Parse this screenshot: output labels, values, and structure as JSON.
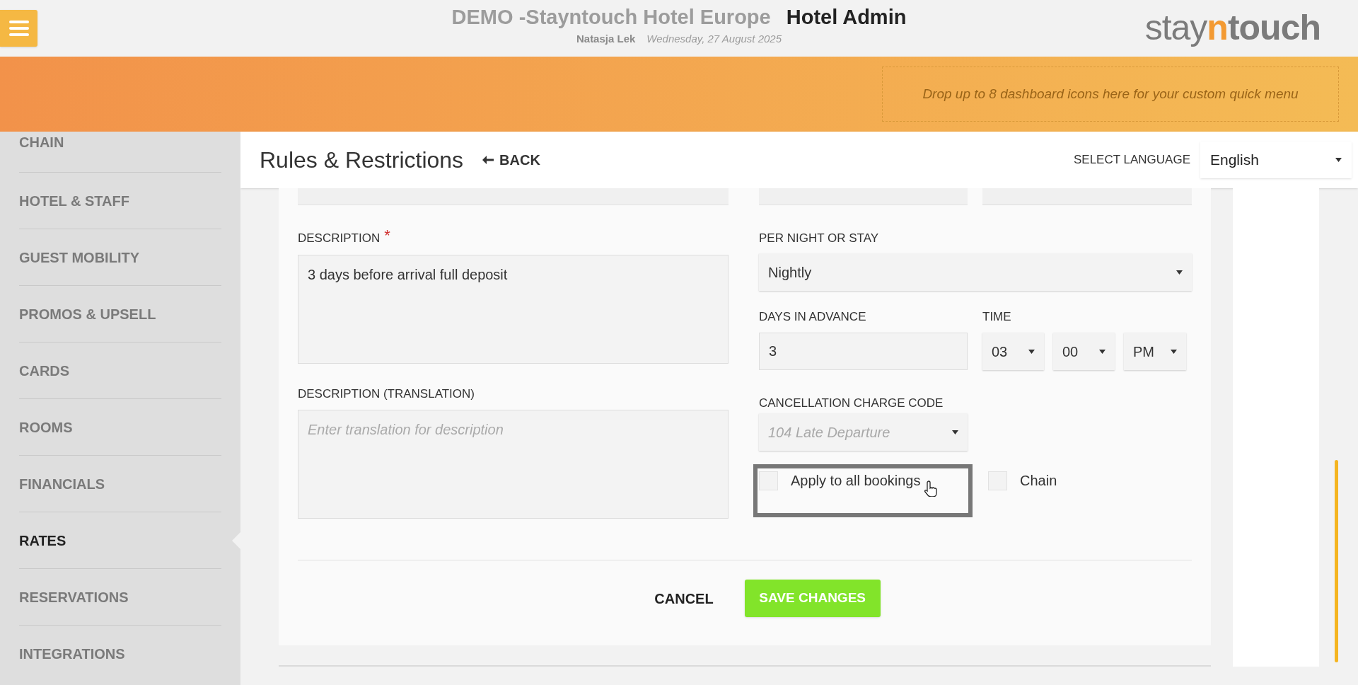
{
  "header": {
    "title": "DEMO -Stayntouch Hotel Europe",
    "app_name": "Hotel Admin",
    "user": "Natasja Lek",
    "date": "Wednesday, 27 August 2025",
    "logo": [
      {
        "text": "stay",
        "color": "#7b7b7b"
      },
      {
        "text": "n",
        "color": "#f39a32"
      },
      {
        "text": "touch",
        "color": "#7b7b7b"
      }
    ]
  },
  "quick_menu": {
    "hint": "Drop up to 8 dashboard icons here for your custom quick menu"
  },
  "sidebar": {
    "items": [
      {
        "label": "CHAIN",
        "selected": false
      },
      {
        "label": "HOTEL & STAFF",
        "selected": false
      },
      {
        "label": "GUEST MOBILITY",
        "selected": false
      },
      {
        "label": "PROMOS & UPSELL",
        "selected": false
      },
      {
        "label": "CARDS",
        "selected": false
      },
      {
        "label": "ROOMS",
        "selected": false
      },
      {
        "label": "FINANCIALS",
        "selected": false
      },
      {
        "label": "RATES",
        "selected": true
      },
      {
        "label": "RESERVATIONS",
        "selected": false
      },
      {
        "label": "INTEGRATIONS",
        "selected": false
      }
    ]
  },
  "page": {
    "title": "Rules & Restrictions",
    "back": "BACK",
    "language_label": "SELECT LANGUAGE",
    "language": "English"
  },
  "form": {
    "description": {
      "label": "DESCRIPTION",
      "required": true,
      "required_mark": "*",
      "value": "3 days before arrival full deposit"
    },
    "description_translation": {
      "label": "DESCRIPTION (TRANSLATION)",
      "placeholder": "Enter translation for description"
    },
    "per_night_or_stay": {
      "label": "PER NIGHT OR STAY",
      "value": "Nightly"
    },
    "days_in_advance": {
      "label": "DAYS IN ADVANCE",
      "value": "3"
    },
    "time": {
      "label": "TIME",
      "hour": "03",
      "minute": "00",
      "period": "PM"
    },
    "cancellation_charge_code": {
      "label": "CANCELLATION CHARGE CODE",
      "value": "104 Late Departure",
      "disabled": true
    },
    "checkboxes": [
      {
        "label": "Apply to all bookings",
        "checked": false,
        "focused": true
      },
      {
        "label": "Chain",
        "checked": false,
        "focused": false
      }
    ]
  },
  "buttons": {
    "cancel": "CANCEL",
    "save": "SAVE CHANGES"
  }
}
